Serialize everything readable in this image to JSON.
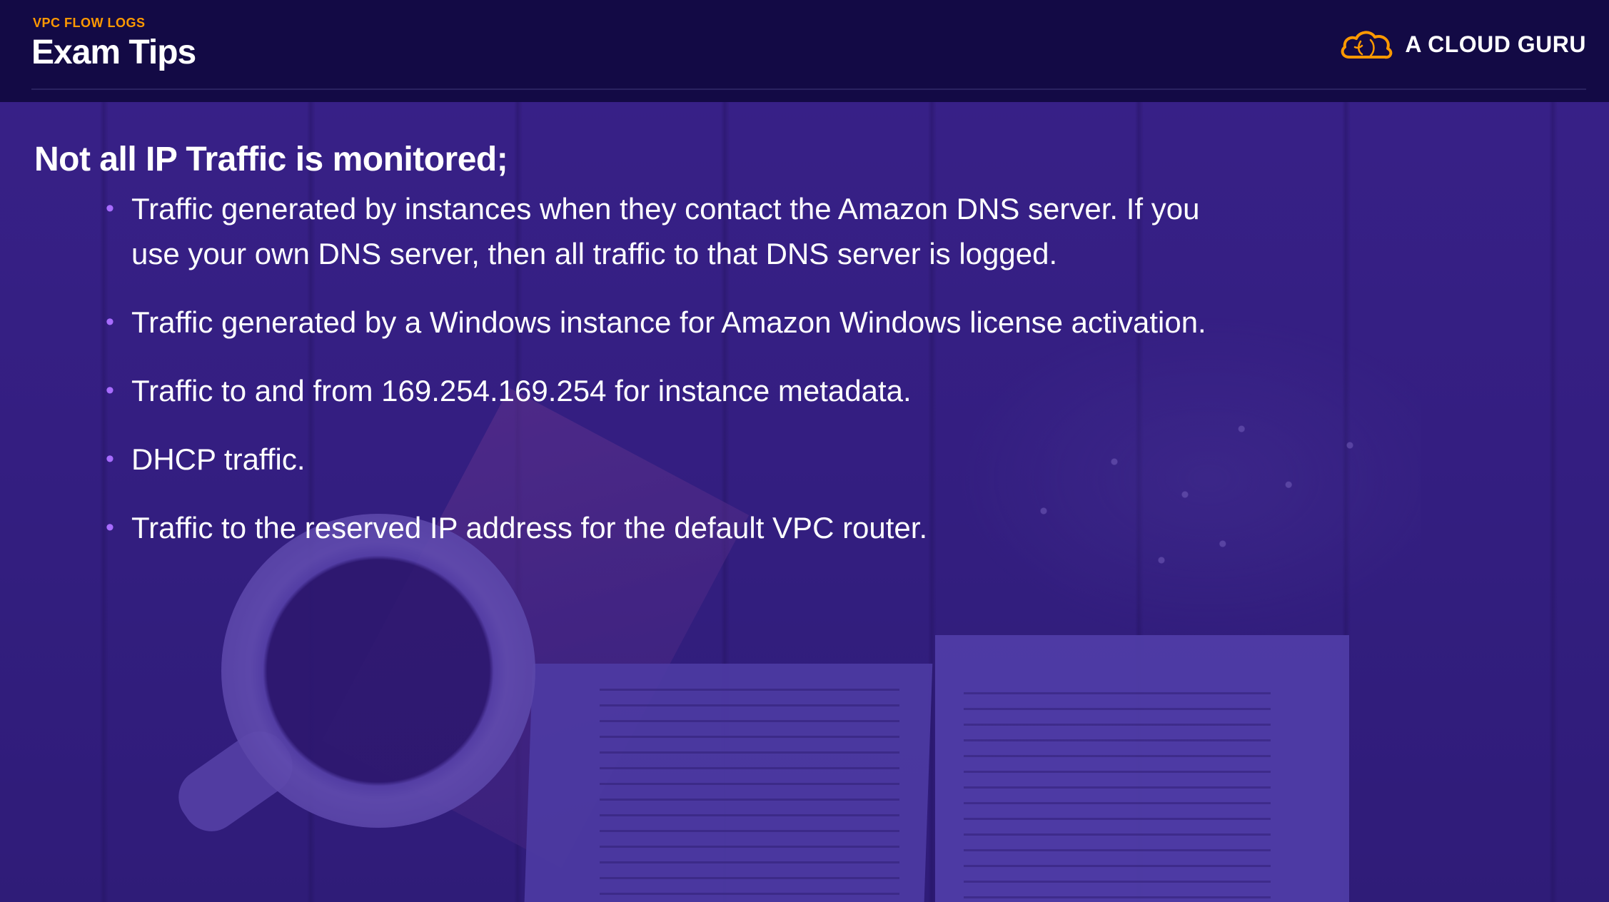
{
  "header": {
    "section_label": "VPC FLOW LOGS",
    "title": "Exam Tips",
    "brand": {
      "name": "A CLOUD GURU",
      "logo_icon": "cloud-icon",
      "accent_color": "#ff9900"
    }
  },
  "main": {
    "heading": "Not all IP Traffic is monitored;",
    "bullets": [
      "Traffic generated by instances when they contact the Amazon DNS server. If you use your own DNS server, then all traffic to that DNS server is logged.",
      "Traffic generated by a Windows instance for Amazon Windows license activation.",
      "Traffic to and from 169.254.169.254 for instance metadata.",
      "DHCP traffic.",
      "Traffic to the reserved IP address for the default VPC router."
    ],
    "bullet_color": "#a86cff"
  },
  "colors": {
    "header_bg": "#130a45",
    "slide_bg": "#2a1a6e",
    "text": "#ffffff"
  }
}
